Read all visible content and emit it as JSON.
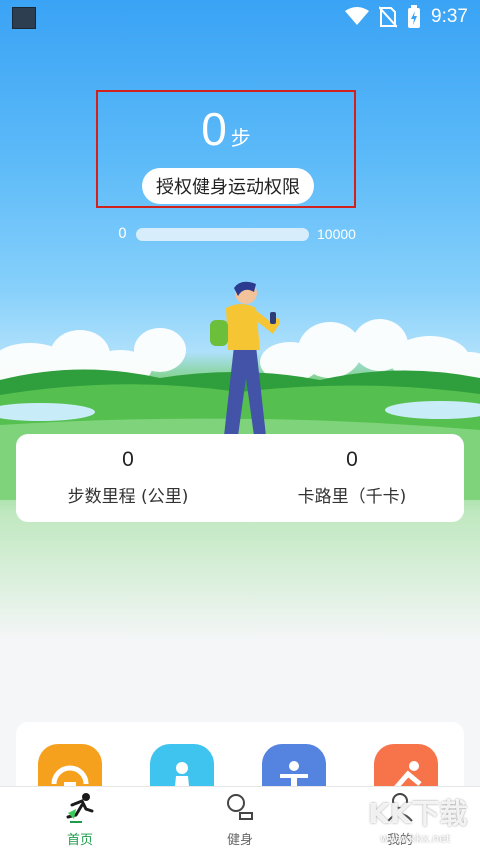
{
  "status_bar": {
    "time": "9:37"
  },
  "step_counter": {
    "steps": "0",
    "unit": "步",
    "authorize_label": "授权健身运动权限"
  },
  "progress": {
    "min": "0",
    "max": "10000",
    "fraction": 0.0
  },
  "stats": [
    {
      "value": "0",
      "label": "步数里程 (公里)"
    },
    {
      "value": "0",
      "label": "卡路里（千卡)"
    }
  ],
  "features": [
    {
      "icon": "gauge-icon",
      "color": "#f6a11d"
    },
    {
      "icon": "person-icon",
      "color": "#3fc3ef"
    },
    {
      "icon": "exercise-icon",
      "color": "#5583e0"
    },
    {
      "icon": "workout-icon",
      "color": "#f7744a"
    }
  ],
  "nav": [
    {
      "label": "首页",
      "icon": "running-icon",
      "active": true
    },
    {
      "label": "健身",
      "icon": "fitness-icon",
      "active": false
    },
    {
      "label": "我的",
      "icon": "profile-icon",
      "active": false
    }
  ],
  "watermark": {
    "text": "KK下载",
    "url": "www.kkx.net"
  },
  "colors": {
    "accent": "#1e9c4a",
    "highlight_border": "#d0211c",
    "sky": "#3aa3f5"
  }
}
